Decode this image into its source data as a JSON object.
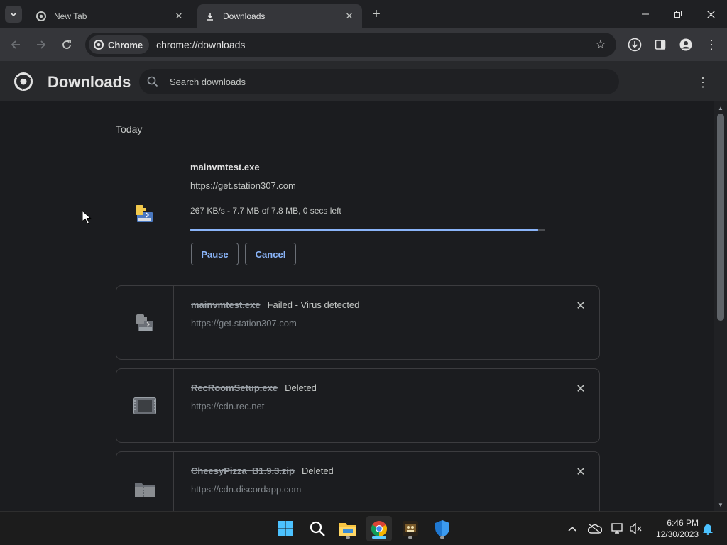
{
  "browser": {
    "tabs": [
      {
        "title": "New Tab",
        "icon": "chrome-icon",
        "active": false
      },
      {
        "title": "Downloads",
        "icon": "download-icon",
        "active": true
      }
    ],
    "omnibox": {
      "site_chip": "Chrome",
      "url": "chrome://downloads"
    }
  },
  "page": {
    "title": "Downloads",
    "search_placeholder": "Search downloads",
    "date_heading": "Today"
  },
  "downloads": {
    "active": {
      "file_name": "mainvmtest.exe",
      "url": "https://get.station307.com",
      "progress_text": "267 KB/s - 7.7 MB of 7.8 MB, 0 secs left",
      "progress_fraction": 0.98,
      "pause_label": "Pause",
      "cancel_label": "Cancel"
    },
    "items": [
      {
        "file_name": "mainvmtest.exe",
        "status": "Failed - Virus detected",
        "url": "https://get.station307.com",
        "icon": "installer-icon"
      },
      {
        "file_name": "RecRoomSetup.exe",
        "status": "Deleted",
        "url": "https://cdn.rec.net",
        "icon": "window-app-icon"
      },
      {
        "file_name": "CheesyPizza_B1.9.3.zip",
        "status": "Deleted",
        "url": "https://cdn.discordapp.com",
        "icon": "zip-folder-icon"
      }
    ]
  },
  "taskbar": {
    "time": "6:46 PM",
    "date": "12/30/2023"
  },
  "colors": {
    "accent": "#8ab4f8",
    "background": "#1b1c1f",
    "toolbar": "#35363a"
  }
}
